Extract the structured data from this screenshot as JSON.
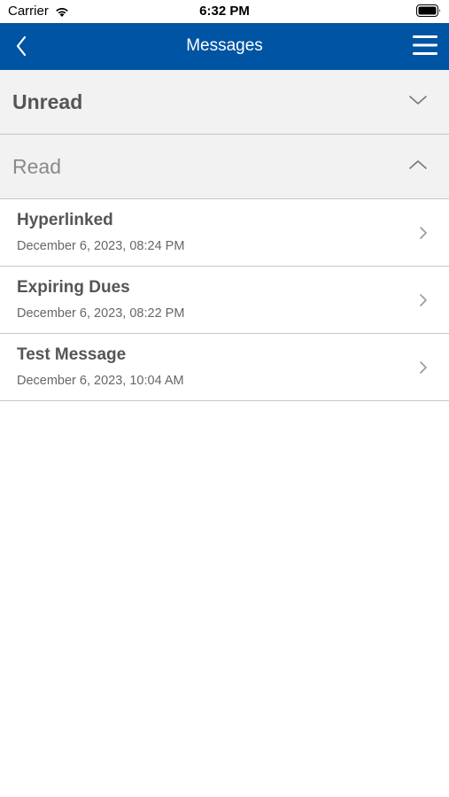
{
  "status_bar": {
    "carrier": "Carrier",
    "time": "6:32 PM",
    "wifi_icon": "wifi-icon",
    "battery_icon": "battery-icon"
  },
  "nav": {
    "title": "Messages",
    "back_icon": "chevron-left-icon",
    "menu_icon": "hamburger-menu-icon",
    "bar_color": "#0054a4"
  },
  "sections": {
    "unread": {
      "label": "Unread",
      "expanded": false
    },
    "read": {
      "label": "Read",
      "expanded": true
    }
  },
  "messages": [
    {
      "title": "Hyperlinked",
      "date": "December 6, 2023, 08:24 PM"
    },
    {
      "title": "Expiring Dues",
      "date": "December 6, 2023, 08:22 PM"
    },
    {
      "title": "Test Message",
      "date": "December 6, 2023, 10:04 AM"
    }
  ]
}
